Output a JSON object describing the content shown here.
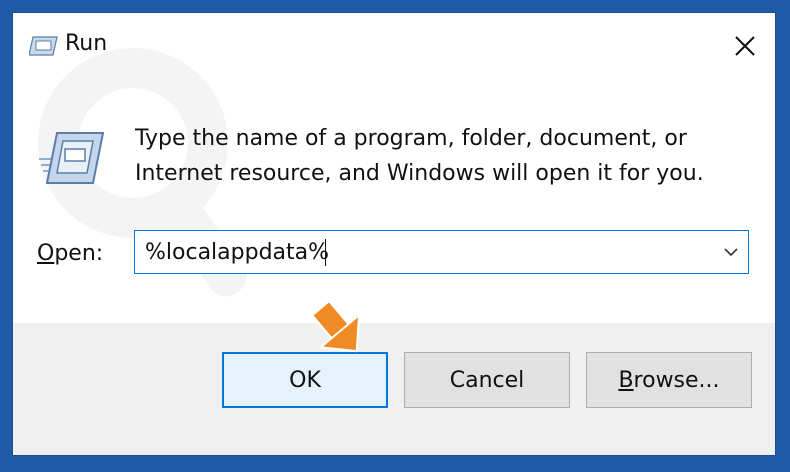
{
  "window": {
    "title": "Run",
    "close_icon": "close-icon",
    "app_icon": "run-icon"
  },
  "description": {
    "line1": "Type the name of a program, folder, document, or",
    "line2": "Internet resource, and Windows will open it for you."
  },
  "open_field": {
    "label_first": "O",
    "label_rest": "pen:",
    "value": "%localappdata%",
    "dropdown_icon": "chevron-down-icon"
  },
  "buttons": {
    "ok": "OK",
    "cancel": "Cancel",
    "browse_first": "B",
    "browse_rest": "rowse..."
  },
  "colors": {
    "accent": "#0078d7",
    "annotation_arrow": "#f08a24",
    "frame": "#1f5aa6"
  }
}
